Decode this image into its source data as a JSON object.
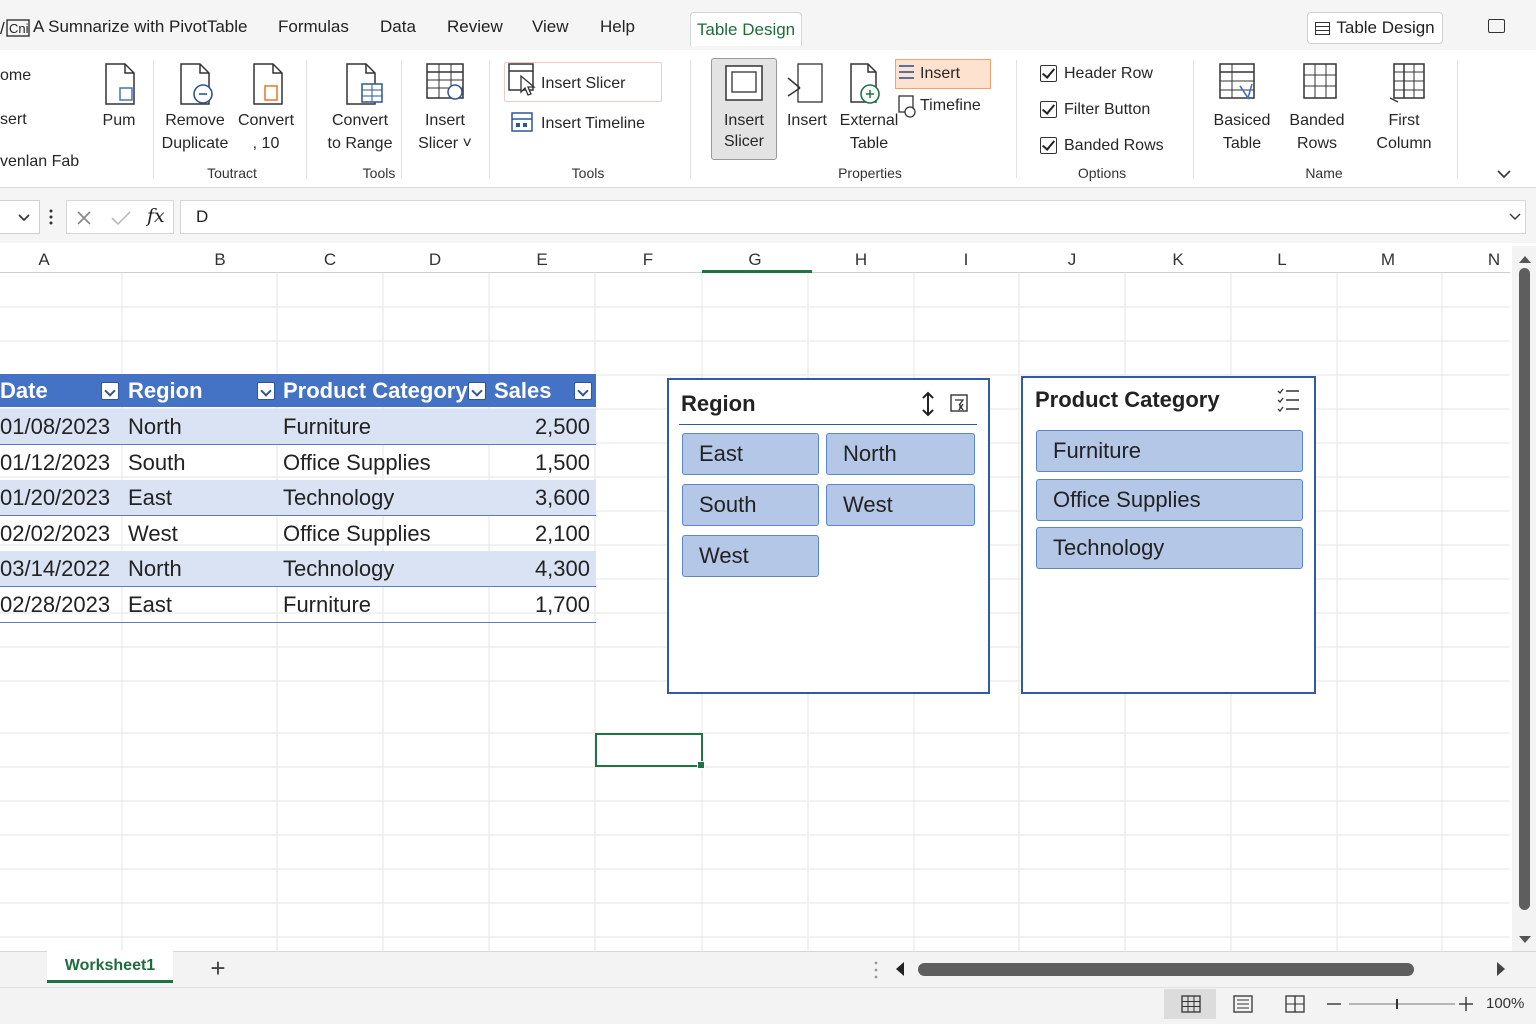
{
  "menu": {
    "first": "A Sumnarize with PivotTable",
    "items": [
      "Formulas",
      "Data",
      "Review",
      "View",
      "Help"
    ],
    "active_tab": "Table Design",
    "right_button": "Table Design"
  },
  "ribbon": {
    "left_items": [
      "ome",
      "sert",
      "venlan Fab"
    ],
    "pum": "Pum",
    "remove_duplicate": [
      "Remove",
      "Duplicate"
    ],
    "convert10": [
      "Convert",
      ", 10"
    ],
    "convert_range": [
      "Convert",
      "to Range"
    ],
    "insert_slicer_mid": [
      "Insert",
      "Slicer ˅"
    ],
    "insert_slicer_small": "Insert Slicer",
    "insert_timeline": "Insert Timeline",
    "insert_slicer_big": [
      "Insert",
      "Slicer"
    ],
    "insert": "Insert",
    "external_table": [
      "External",
      "Table"
    ],
    "insert_orange": "Insert",
    "timefine": "Timefine",
    "options": [
      "Header Row",
      "Filter Button",
      "Banded Rows"
    ],
    "basiced_table": [
      "Basiced",
      "Table"
    ],
    "banded_rows": [
      "Banded",
      "Rows"
    ],
    "first_column": [
      "First",
      "Column"
    ],
    "groups": {
      "toutract": "Toutract",
      "tools1": "Tools",
      "tools2": "Tools",
      "properties": "Properties",
      "options": "Options",
      "name": "Name"
    }
  },
  "formula": {
    "fx": "fx",
    "value": "D"
  },
  "columns": [
    "A",
    "B",
    "C",
    "D",
    "E",
    "F",
    "G",
    "H",
    "I",
    "J",
    "K",
    "L",
    "M",
    "N"
  ],
  "table": {
    "headers": [
      "Date",
      "Region",
      "Product Category",
      "Sales"
    ],
    "rows": [
      [
        "01/08/2023",
        "North",
        "Furniture",
        "2,500"
      ],
      [
        "01/12/2023",
        "South",
        "Office Supplies",
        "1,500"
      ],
      [
        "01/20/2023",
        "East",
        "Technology",
        "3,600"
      ],
      [
        "02/02/2023",
        "West",
        "Office Supplies",
        "2,100"
      ],
      [
        "03/14/2022",
        "North",
        "Technology",
        "4,300"
      ],
      [
        "02/28/2023",
        "East",
        "Furniture",
        "1,700"
      ]
    ]
  },
  "slicer_region": {
    "title": "Region",
    "items": [
      "East",
      "North",
      "South",
      "West",
      "West"
    ]
  },
  "slicer_category": {
    "title": "Product Category",
    "items": [
      "Furniture",
      "Office Supplies",
      "Technology"
    ]
  },
  "sheet": {
    "tab": "Worksheet1",
    "add": "+"
  },
  "status": {
    "zoom": "100%"
  },
  "colors": {
    "accent": "#217346",
    "table_header": "#4472c4",
    "band": "#dae3f3",
    "slicer_item": "#b4c7e7"
  }
}
